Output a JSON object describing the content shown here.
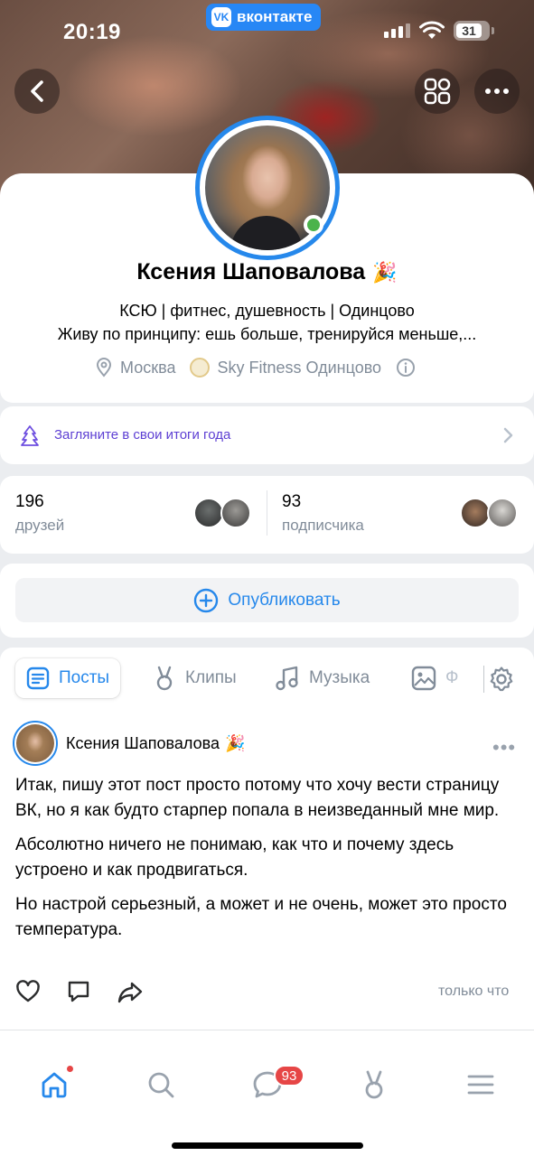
{
  "status_bar": {
    "time": "20:19",
    "app_pill": "вконтакте",
    "app_pill_logo": "VK",
    "battery": "31"
  },
  "profile": {
    "name": "Ксения Шаповалова",
    "name_badge_icon": "party-emoji-icon",
    "status": "КСЮ | фитнес, душевность | Одинцово",
    "about": "Живу по принципу: ешь больше, тренируйся меньше,...",
    "city": "Москва",
    "workplace": "Sky Fitness Одинцово",
    "online": true
  },
  "year_banner": {
    "text": "Загляните в свои итоги года"
  },
  "stats": {
    "friends_count": "196",
    "friends_label": "друзей",
    "followers_count": "93",
    "followers_label": "подписчика"
  },
  "publish": {
    "label": "Опубликовать"
  },
  "tabs": {
    "posts": "Посты",
    "clips": "Клипы",
    "music": "Музыка",
    "photos_partial": "Ф"
  },
  "post": {
    "author": "Ксения Шаповалова",
    "paragraphs": [
      "Итак, пишу этот пост просто потому что хочу вести страницу ВК, но я как будто старпер попала в неизведанный мне мир.",
      "Абсолютно ничего не понимаю, как что и почему здесь устроено и как продвигаться.",
      "Но настрой серьезный, а может и не очень, может это просто температура."
    ],
    "time": "только что"
  },
  "bottom_nav": {
    "messages_badge": "93"
  },
  "colors": {
    "accent": "#2688eb",
    "online": "#4bb34b",
    "badge": "#e64646",
    "year_banner_text": "#5d3fd3"
  }
}
